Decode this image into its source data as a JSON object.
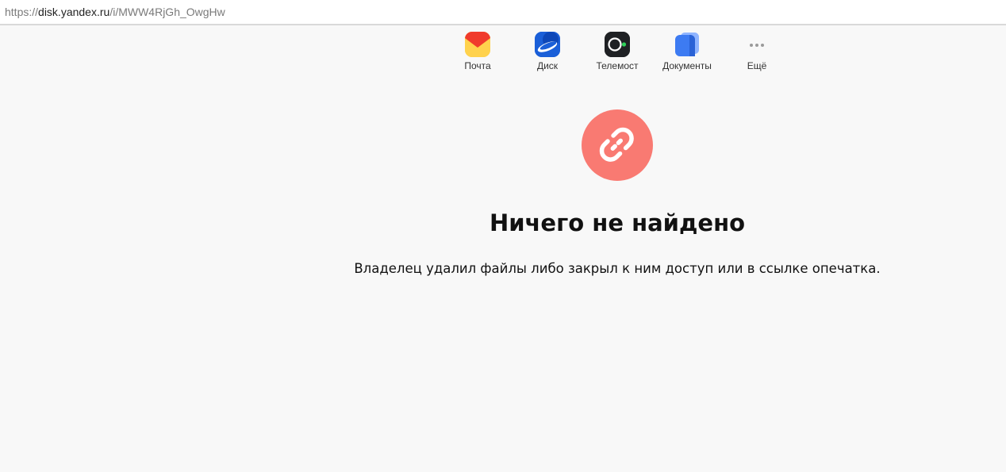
{
  "address_bar": {
    "scheme": "https://",
    "host": "disk.yandex.ru",
    "path": "/i/MWW4RjGh_OwgHw"
  },
  "services": [
    {
      "label": "Почта",
      "icon": "mail-icon"
    },
    {
      "label": "Диск",
      "icon": "disk-icon"
    },
    {
      "label": "Телемост",
      "icon": "telemost-icon"
    },
    {
      "label": "Документы",
      "icon": "documents-icon"
    },
    {
      "label": "Ещё",
      "icon": "more-dots-icon"
    }
  ],
  "error": {
    "icon": "broken-link-icon",
    "title": "Ничего не найдено",
    "message": "Владелец удалил файлы либо закрыл к ним доступ или в ссылке опечатка."
  },
  "colors": {
    "background": "#f8f8f8",
    "error_circle": "#f97a72",
    "mail": "#ffd24d",
    "disk": "#1a5fd8",
    "telemost": "#1f2124",
    "documents": "#3d7bf2",
    "status_dot": "#2fd35a"
  }
}
